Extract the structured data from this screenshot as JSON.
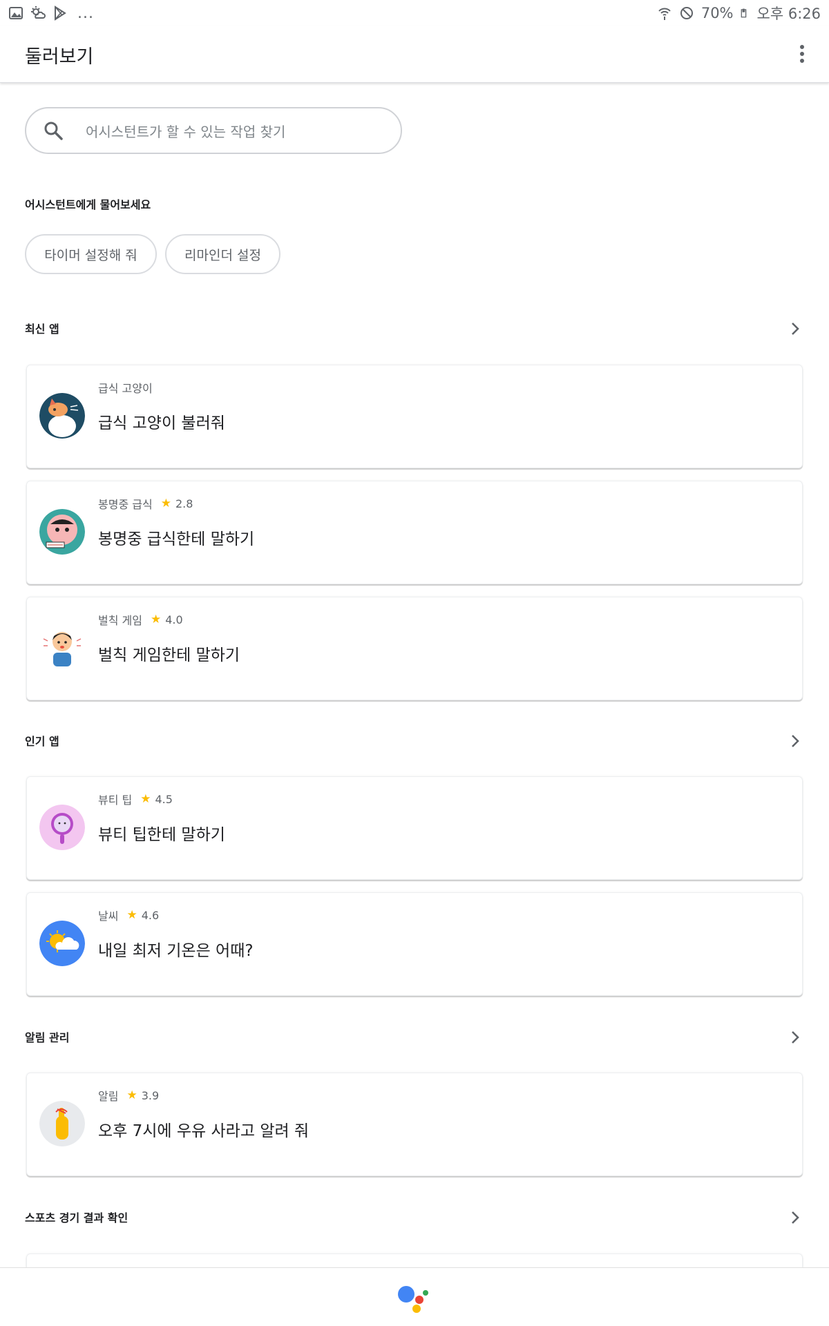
{
  "status_bar": {
    "left_icons": [
      "gallery-icon",
      "weather-icon",
      "play-store-icon"
    ],
    "overflow": "...",
    "battery": "70%",
    "time": "오후 6:26"
  },
  "app_bar": {
    "title": "둘러보기"
  },
  "search": {
    "placeholder": "어시스턴트가 할 수 있는 작업 찾기"
  },
  "ask": {
    "label": "어시스턴트에게 물어보세요",
    "chips": [
      "타이머 설정해 줘",
      "리마인더 설정"
    ]
  },
  "sections": [
    {
      "label": "최신 앱",
      "cards": [
        {
          "app": "급식 고양이",
          "rating": "",
          "title": "급식 고양이 불러줘",
          "avatar": "cat-avatar"
        },
        {
          "app": "봉명중 급식",
          "rating": "2.8",
          "title": "봉명중 급식한테 말하기",
          "avatar": "meal-avatar"
        },
        {
          "app": "벌칙 게임",
          "rating": "4.0",
          "title": "벌칙 게임한테 말하기",
          "avatar": "boy-avatar"
        }
      ]
    },
    {
      "label": "인기 앱",
      "cards": [
        {
          "app": "뷰티 팁",
          "rating": "4.5",
          "title": "뷰티 팁한테 말하기",
          "avatar": "mirror-avatar"
        },
        {
          "app": "날씨",
          "rating": "4.6",
          "title": "내일 최저 기온은 어때?",
          "avatar": "weather-avatar"
        }
      ]
    },
    {
      "label": "알림 관리",
      "cards": [
        {
          "app": "알림",
          "rating": "3.9",
          "title": "오후 7시에 우유 사라고 알려 줘",
          "avatar": "reminder-avatar"
        }
      ]
    },
    {
      "label": "스포츠 경기 결과 확인",
      "cards": []
    }
  ],
  "colors": {
    "star": "#fbbc04",
    "assistant_blue": "#4285f4",
    "assistant_red": "#ea4335",
    "assistant_yellow": "#fbbc04",
    "assistant_green": "#34a853"
  }
}
